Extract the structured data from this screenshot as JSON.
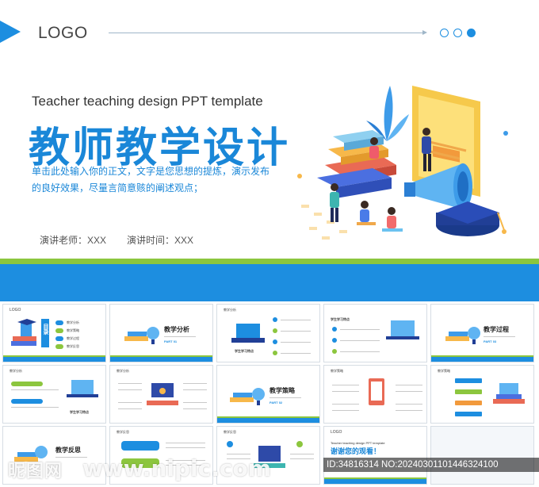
{
  "hero": {
    "logo": "LOGO",
    "subtitle_en": "Teacher teaching design PPT template",
    "title_cn": "教师教学设计",
    "intro": "单击此处输入你的正文，文字是您思想的提炼，演示发布的良好效果，尽量言简意赅的阐述观点；",
    "teacher": "演讲老师：XXX",
    "time": "演讲时间：XXX",
    "colors": {
      "primary": "#1d8ee0",
      "green": "#8cc63e",
      "yellow": "#f5b82e"
    }
  },
  "thumbs": {
    "t1": {
      "logo": "LOGO",
      "toc": "目录",
      "items": [
        "教学分析",
        "教学策略",
        "教学过程",
        "教学反思"
      ]
    },
    "t2": {
      "title": "教学分析",
      "part": "PART 01"
    },
    "t3": {
      "header": "教学分析",
      "caption": "学生学习特点"
    },
    "t4": {
      "header": "学生学习特点"
    },
    "t5": {
      "title": "教学过程",
      "part": "PART 03"
    },
    "t6": {
      "header": "教学分析",
      "caption": "学生学习特点"
    },
    "t7": {
      "header": "教学分析"
    },
    "t8": {
      "title": "教学策略",
      "part": "PART 02"
    },
    "t9": {
      "header": "教学策略"
    },
    "t10": {
      "header": "教学策略"
    },
    "t11": {
      "title": "教学反思"
    },
    "t12": {
      "header": "教学反思"
    },
    "t13": {
      "header": "教学反思"
    },
    "t14": {
      "logo": "LOGO",
      "subtitle": "Teacher teaching design PPT template",
      "title": "谢谢您的观看！"
    }
  },
  "watermark": {
    "site_cn": "昵图网",
    "site_url": "www.nipic.com",
    "id_text": "ID:34816314 NO:20240301101446324100"
  }
}
